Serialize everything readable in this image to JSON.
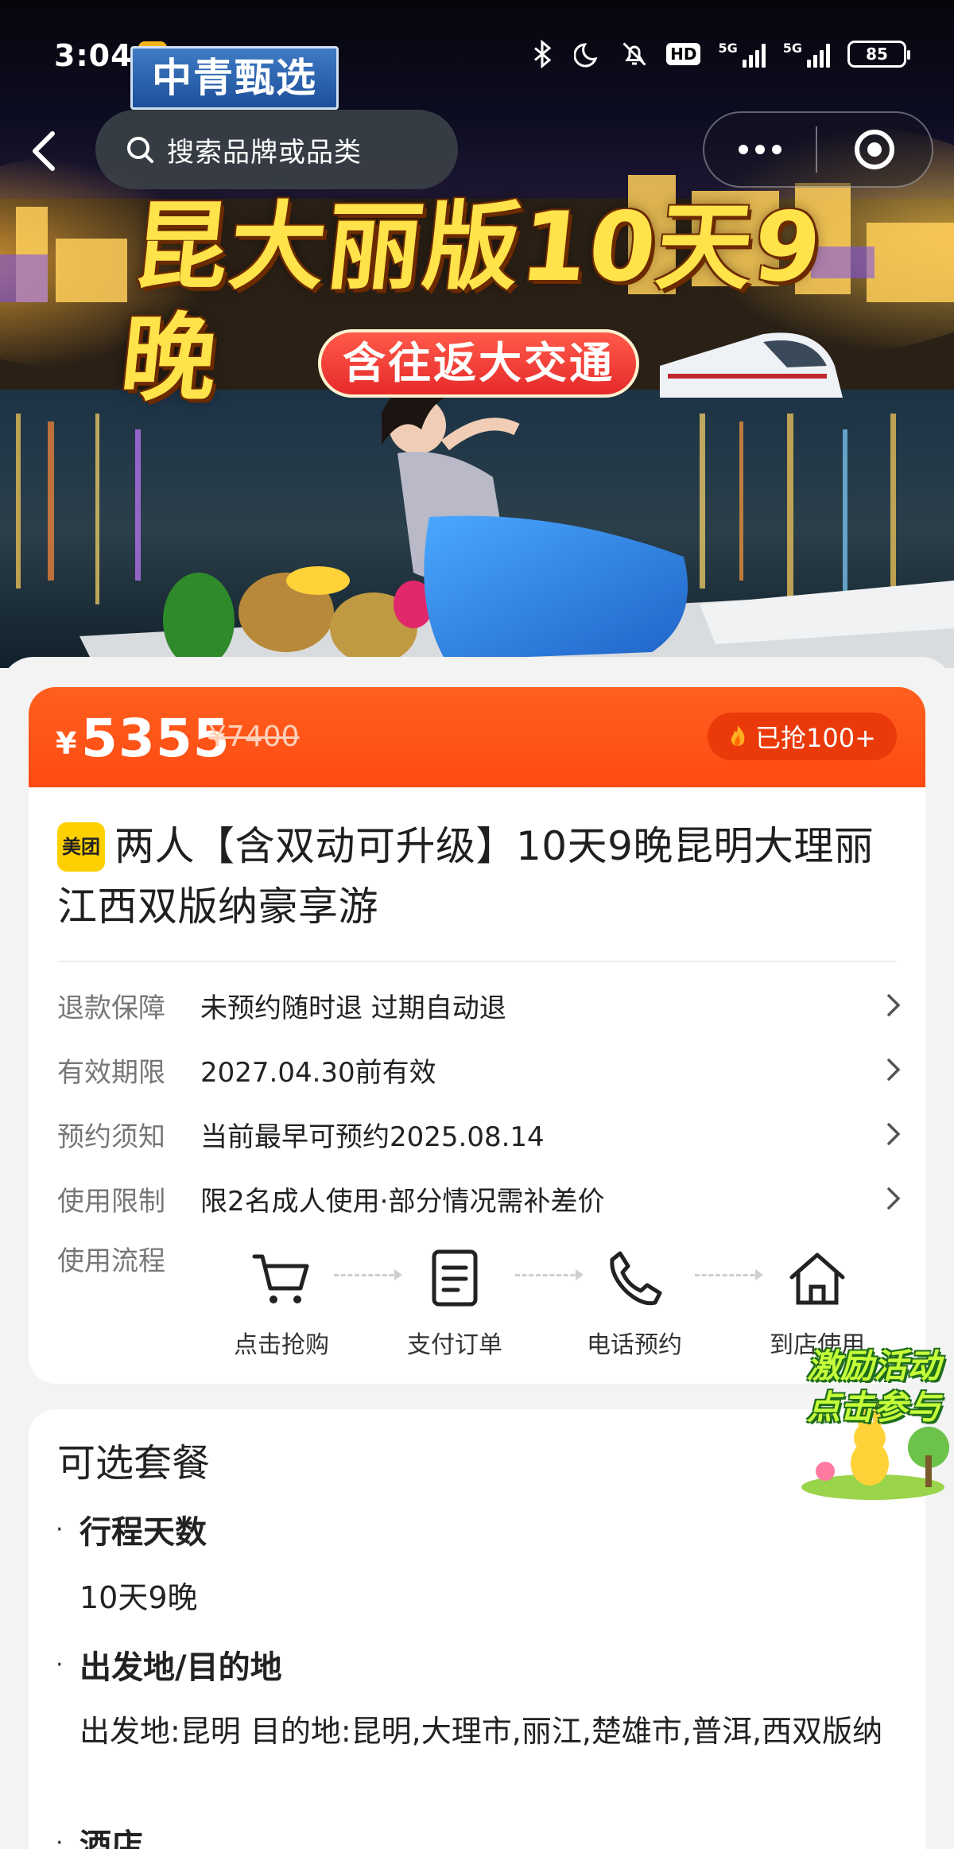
{
  "status_bar": {
    "time": "3:04",
    "dots": "· · ·",
    "hd": "HD",
    "net1": "5G",
    "net2": "5G",
    "battery": "85",
    "icons": [
      "bluetooth-icon",
      "moon-icon",
      "mute-icon",
      "signal-icon",
      "signal-icon",
      "battery-icon"
    ]
  },
  "hero": {
    "brand_tag": "中青甄选",
    "headline": "昆大丽版10天9晚",
    "subhead": "含往返大交通"
  },
  "nav": {
    "search_placeholder": "搜索品牌或品类"
  },
  "price": {
    "currency": "¥",
    "current": "5355",
    "original": "¥7400",
    "sold_label": "已抢100+"
  },
  "product": {
    "platform_badge": "美团",
    "title": "两人【含双动可升级】10天9晚昆明大理丽江西双版纳豪享游"
  },
  "info_rows": [
    {
      "label": "退款保障",
      "value": "未预约随时退 过期自动退"
    },
    {
      "label": "有效期限",
      "value": "2027.04.30前有效"
    },
    {
      "label": "预约须知",
      "value": "当前最早可预约2025.08.14"
    },
    {
      "label": "使用限制",
      "value": "限2名成人使用·部分情况需补差价"
    }
  ],
  "usage_flow": {
    "label": "使用流程",
    "steps": [
      {
        "label": "点击抢购",
        "icon": "cart-icon"
      },
      {
        "label": "支付订单",
        "icon": "document-icon"
      },
      {
        "label": "电话预约",
        "icon": "phone-icon"
      },
      {
        "label": "到店使用",
        "icon": "home-icon"
      }
    ]
  },
  "promo": {
    "line1": "激励活动",
    "line2": "点击参与"
  },
  "packages": {
    "title": "可选套餐",
    "bullet": "·",
    "options": [
      {
        "heading": "行程天数",
        "value": "10天9晚"
      },
      {
        "heading": "出发地/目的地",
        "value": "出发地:昆明 目的地:昆明,大理市,丽江,楚雄市,普洱,西双版纳"
      },
      {
        "heading": "酒店",
        "value": ""
      }
    ]
  },
  "colors": {
    "accent_orange": "#FF4F14",
    "badge_yellow": "#FFD000",
    "page_bg": "#F3F3F3"
  }
}
